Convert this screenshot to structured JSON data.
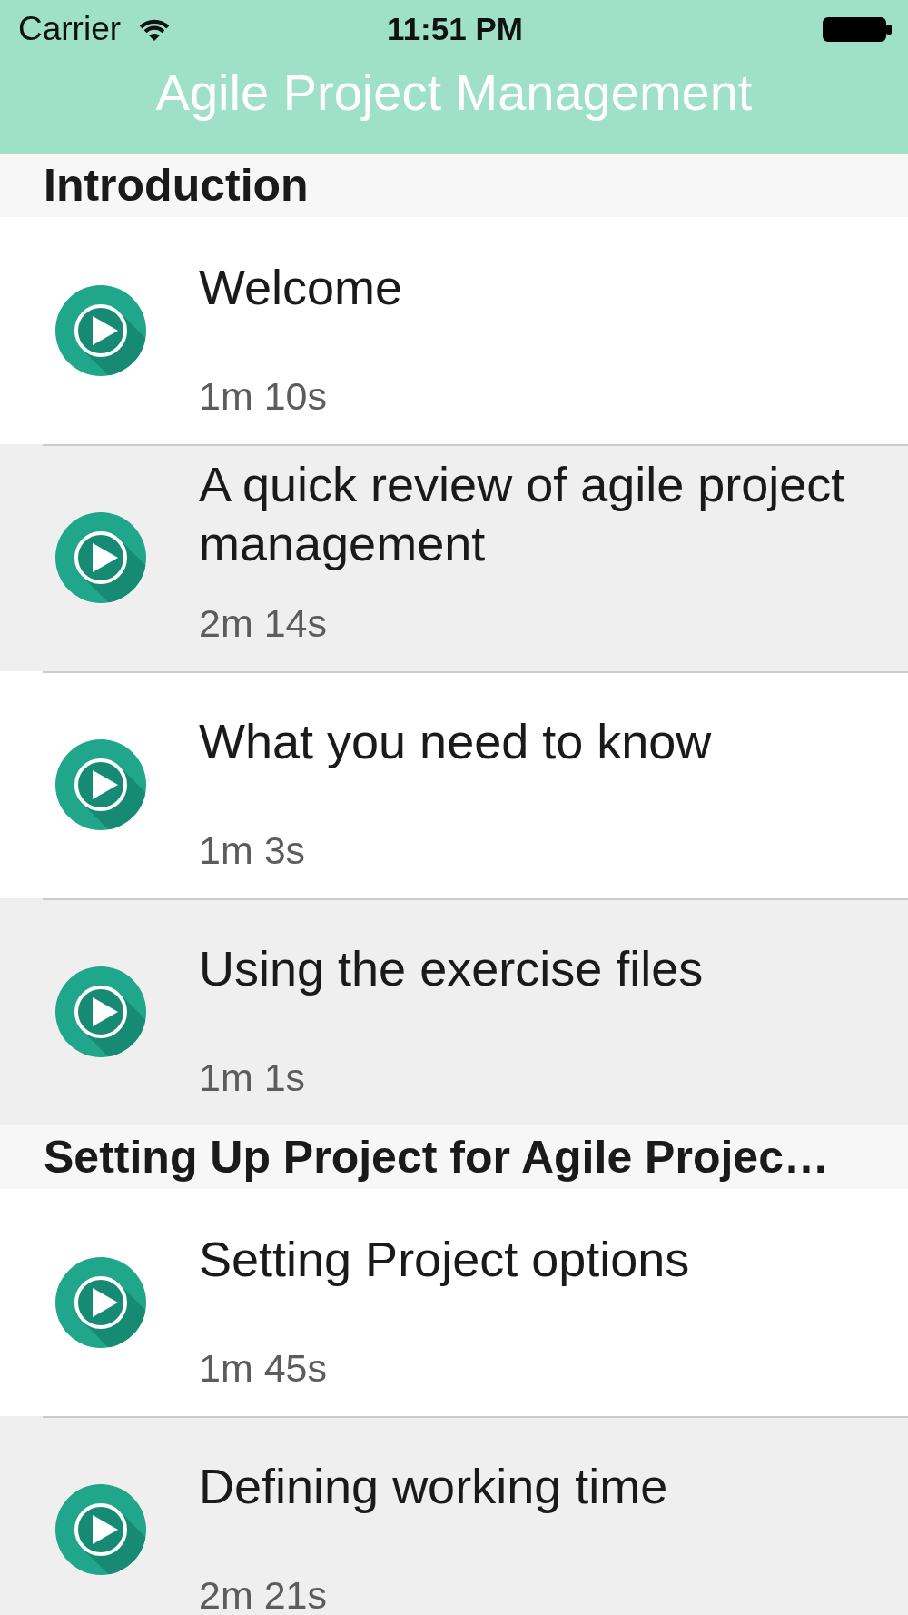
{
  "status_bar": {
    "carrier": "Carrier",
    "time": "11:51 PM"
  },
  "nav_bar": {
    "title": "Agile Project Management"
  },
  "sections": [
    {
      "title": "Introduction",
      "lessons": [
        {
          "title": "Welcome",
          "duration": "1m 10s"
        },
        {
          "title": "A quick review of agile project management",
          "duration": "2m 14s"
        },
        {
          "title": "What you need to know",
          "duration": "1m 3s"
        },
        {
          "title": "Using the exercise files",
          "duration": "1m 1s"
        }
      ]
    },
    {
      "title": "Setting Up Project for Agile Projec…",
      "lessons": [
        {
          "title": "Setting Project options",
          "duration": "1m 45s"
        },
        {
          "title": "Defining working time",
          "duration": "2m 21s"
        }
      ]
    }
  ]
}
